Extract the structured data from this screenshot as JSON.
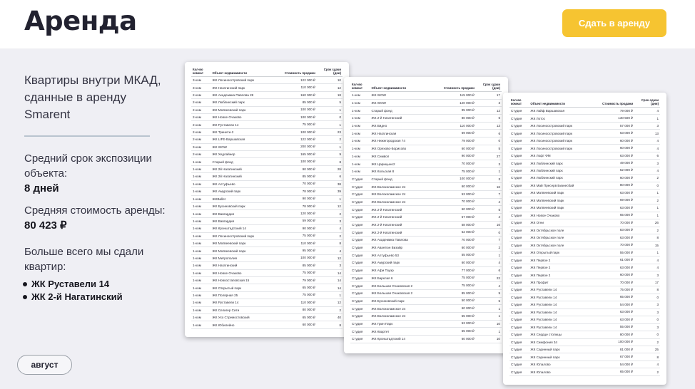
{
  "header": {
    "title": "Аренда",
    "cta_label": "Сдать в аренду"
  },
  "intro": "Квартиры внутри МКАД, сданные в аренду Smarent",
  "stats": {
    "avg_exposure_label": "Средний срок экспозиции объекта:",
    "avg_exposure_value": "8 дней",
    "avg_price_label": "Средняя стоимость аренды:",
    "avg_price_value": "80 423 ₽"
  },
  "most_rented": {
    "label": "Больше всего мы сдали квартир:",
    "items": [
      "ЖК Руставели 14",
      "ЖК 2-й Нагатинский"
    ]
  },
  "month_chip": "август",
  "table_headers": [
    "Кол-во комнат",
    "Объект недвижимости",
    "Стоимость продажи",
    "Срок сдачи (дни)"
  ],
  "sheets": [
    {
      "rows": [
        [
          "3-ком",
          "ЖК Лосиноостровский парк",
          "122 000 ₽",
          "10"
        ],
        [
          "3-ком",
          "ЖК Нагатинский парк",
          "110 000 ₽",
          "12"
        ],
        [
          "2-ком",
          "ЖК Академика Павлова 28",
          "160 000 ₽",
          "18"
        ],
        [
          "2-ком",
          "ЖК Люблинский парк",
          "85 000 ₽",
          "5"
        ],
        [
          "2-ком",
          "ЖК Матвеевский парк",
          "100 000 ₽",
          "1"
        ],
        [
          "2-ком",
          "ЖК Новое Очаково",
          "100 000 ₽",
          "0"
        ],
        [
          "2-ком",
          "ЖК Руставели 14",
          "75 000 ₽",
          "1"
        ],
        [
          "2-ком",
          "ЖК Тринити-2",
          "100 000 ₽",
          "23"
        ],
        [
          "2-ком",
          "ЖК LIFE-Варшавская",
          "122 000 ₽",
          "2"
        ],
        [
          "3-ком",
          "ЖК WOW",
          "200 000 ₽",
          "1"
        ],
        [
          "2-ком",
          "ЖК Хедлайнер",
          "165 000 ₽",
          "9"
        ],
        [
          "1-ком",
          "Старый фонд",
          "100 000 ₽",
          "8"
        ],
        [
          "1-ком",
          "ЖК 2й Нагатинский",
          "90 000 ₽",
          "28"
        ],
        [
          "1-ком",
          "ЖК 2й Нагатинский",
          "85 000 ₽",
          "6"
        ],
        [
          "1-ком",
          "ЖК Алтуфьево",
          "70 000 ₽",
          "38"
        ],
        [
          "1-ком",
          "ЖК Амурский парк",
          "78 000 ₽",
          "39"
        ],
        [
          "1-ком",
          "ЖКBallet",
          "90 000 ₽",
          "1"
        ],
        [
          "1-ком",
          "ЖК Бусиновский парк",
          "78 000 ₽",
          "12"
        ],
        [
          "1-ком",
          "ЖК Вавгардия",
          "120 000 ₽",
          "2"
        ],
        [
          "1-ком",
          "ЖК Вавгардия",
          "59 000 ₽",
          "3"
        ],
        [
          "1-ком",
          "ЖК Кронштадтский 14",
          "90 000 ₽",
          "4"
        ],
        [
          "1-ком",
          "ЖК Лосиноостровский парк",
          "75 000 ₽",
          "2"
        ],
        [
          "1-ком",
          "ЖК Матвеевский парк",
          "110 000 ₽",
          "8"
        ],
        [
          "1-ком",
          "ЖК Матвеевский парк",
          "95 000 ₽",
          "4"
        ],
        [
          "1-ком",
          "ЖК Митрополия",
          "100 000 ₽",
          "12"
        ],
        [
          "1-ком",
          "ЖК Нагатинский",
          "85 000 ₽",
          "3"
        ],
        [
          "1-ком",
          "ЖК Новое Очаково",
          "75 000 ₽",
          "14"
        ],
        [
          "1-ком",
          "ЖК Новоостаповская 15",
          "79 000 ₽",
          "14"
        ],
        [
          "1-ком",
          "ЖК Открытый парк",
          "65 000 ₽",
          "14"
        ],
        [
          "1-ком",
          "ЖК Полярная 25",
          "75 000 ₽",
          "1"
        ],
        [
          "1-ком",
          "ЖК Руставели 14",
          "110 000 ₽",
          "12"
        ],
        [
          "1-ком",
          "ЖК Селигер Сити",
          "80 000 ₽",
          "2"
        ],
        [
          "1-ком",
          "ЖК Ухо Стремостовский",
          "65 000 ₽",
          "40"
        ],
        [
          "1-ком",
          "ЖК Юбилейно",
          "60 000 ₽",
          "8"
        ]
      ]
    },
    {
      "rows": [
        [
          "1-ком",
          "ЖК WOW",
          "115 000 ₽",
          "17"
        ],
        [
          "1-ком",
          "ЖК WOW",
          "120 000 ₽",
          "3"
        ],
        [
          "1-ком",
          "Старый фонд",
          "95 000 ₽",
          "12"
        ],
        [
          "1-ком",
          "ЖК 2-й Нагатинский",
          "80 000 ₽",
          "6"
        ],
        [
          "1-ком",
          "ЖК Видно",
          "110 000 ₽",
          "13"
        ],
        [
          "1-ком",
          "ЖК Нагатинская",
          "69 000 ₽",
          "6"
        ],
        [
          "1-ком",
          "ЖК Нижегородская 74",
          "79 000 ₽",
          "0"
        ],
        [
          "1-ком",
          "ЖК Орехово-Борисово",
          "60 000 ₽",
          "5"
        ],
        [
          "1-ком",
          "ЖК Символ",
          "90 000 ₽",
          "27"
        ],
        [
          "1-ком",
          "ЖК Царицыно2",
          "70 000 ₽",
          "3"
        ],
        [
          "1-ком",
          "ЖК Кольская 8",
          "75 000 ₽",
          "1"
        ],
        [
          "Студия",
          "Старый фонд",
          "100 000 ₽",
          "3"
        ],
        [
          "Студия",
          "ЖК Волоколамское 24",
          "60 000 ₽",
          "16"
        ],
        [
          "Студия",
          "ЖК Волоколамское 24",
          "53 000 ₽",
          "7"
        ],
        [
          "Студия",
          "ЖК Волоколамское 24",
          "70 000 ₽",
          "4"
        ],
        [
          "Студия",
          "ЖК 2-й Нагатинский",
          "60 000 ₽",
          "5"
        ],
        [
          "Студия",
          "ЖК 2-й Нагатинский",
          "57 000 ₽",
          "4"
        ],
        [
          "Студия",
          "ЖК 2-й Нагатинский",
          "58 000 ₽",
          "16"
        ],
        [
          "Студия",
          "ЖК 2-й Нагатинский",
          "52 000 ₽",
          "0"
        ],
        [
          "Студия",
          "ЖК Академика Павлова",
          "70 000 ₽",
          "7"
        ],
        [
          "Студия",
          "ЖК Авантюн Визайр",
          "60 000 ₽",
          "2"
        ],
        [
          "Студия",
          "ЖК Алтуфьево 53",
          "55 000 ₽",
          "1"
        ],
        [
          "Студия",
          "ЖК Амурский парк",
          "60 000 ₽",
          "4"
        ],
        [
          "Студия",
          "ЖК Афи Тауэр",
          "77 000 ₽",
          "6"
        ],
        [
          "Студия",
          "ЖК Барклая 6",
          "75 000 ₽",
          "22"
        ],
        [
          "Студия",
          "ЖК Большая Очаковская 2",
          "75 000 ₽",
          "4"
        ],
        [
          "Студия",
          "ЖК Большая Очаковская 2",
          "85 000 ₽",
          "9"
        ],
        [
          "Студия",
          "ЖК Бусиновский парк",
          "50 000 ₽",
          "5"
        ],
        [
          "Студия",
          "ЖК Волоколамское 24",
          "60 000 ₽",
          "1"
        ],
        [
          "Студия",
          "ЖК Волоколамское 24",
          "55 000 ₽",
          "1"
        ],
        [
          "Студия",
          "ЖК Грин Парк",
          "53 000 ₽",
          "10"
        ],
        [
          "Студия",
          "ЖК Квартет",
          "55 000 ₽",
          "1"
        ],
        [
          "Студия",
          "ЖК Кронштадтский 14",
          "60 000 ₽",
          "10"
        ]
      ]
    },
    {
      "rows": [
        [
          "Студия",
          "ЖК Лайф Варшавская",
          "79 000 ₽",
          "4"
        ],
        [
          "Студия",
          "ЖК Лотос",
          "130 500 ₽",
          "1"
        ],
        [
          "Студия",
          "ЖК Лосиноостровский парк",
          "57 000 ₽",
          "3"
        ],
        [
          "Студия",
          "ЖК Лосиноостровский парк",
          "63 000 ₽",
          "13"
        ],
        [
          "Студия",
          "ЖК Лосиноостровский парк",
          "60 000 ₽",
          "4"
        ],
        [
          "Студия",
          "ЖК Лосиноостровский парк",
          "60 000 ₽",
          "4"
        ],
        [
          "Студия",
          "ЖК Лофт ФМ",
          "63 000 ₽",
          "6"
        ],
        [
          "Студия",
          "ЖК Люблинский парк",
          "49 000 ₽",
          "3"
        ],
        [
          "Студия",
          "ЖК Люблинский парк",
          "52 000 ₽",
          "4"
        ],
        [
          "Студия",
          "ЖК Люблинский парк",
          "60 000 ₽",
          "2"
        ],
        [
          "Студия",
          "ЖК Май Пресерв Бизнесбай",
          "80 000 ₽",
          "0"
        ],
        [
          "Студия",
          "ЖК Матвеевский парк",
          "63 000 ₽",
          "1"
        ],
        [
          "Студия",
          "ЖК Матвеевский парк",
          "69 000 ₽",
          "2"
        ],
        [
          "Студия",
          "ЖК Матвеевский парк",
          "63 000 ₽",
          "1"
        ],
        [
          "Студия",
          "ЖК Новое Очаково",
          "65 000 ₽",
          "1"
        ],
        [
          "Студия",
          "ЖК Огни",
          "70 000 ₽",
          "26"
        ],
        [
          "Студия",
          "ЖК Октябрьское поле",
          "83 000 ₽",
          "2"
        ],
        [
          "Студия",
          "ЖК Октябрьское поле",
          "63 000 ₽",
          "8"
        ],
        [
          "Студия",
          "ЖК Октябрьское поле",
          "70 000 ₽",
          "15"
        ],
        [
          "Студия",
          "ЖК Открытый парк",
          "55 000 ₽",
          "1"
        ],
        [
          "Студия",
          "ЖК Первое 2",
          "61 000 ₽",
          "4"
        ],
        [
          "Студия",
          "ЖК Первое 2",
          "63 000 ₽",
          "4"
        ],
        [
          "Студия",
          "ЖК Первое 2",
          "60 000 ₽",
          "3"
        ],
        [
          "Студия",
          "ЖК Профит",
          "70 000 ₽",
          "17"
        ],
        [
          "Студия",
          "ЖК Руставели 14",
          "75 000 ₽",
          "8"
        ],
        [
          "Студия",
          "ЖК Руставели 14",
          "65 000 ₽",
          "0"
        ],
        [
          "Студия",
          "ЖК Руставели 14",
          "54 000 ₽",
          "3"
        ],
        [
          "Студия",
          "ЖК Руставели 14",
          "63 000 ₽",
          "3"
        ],
        [
          "Студия",
          "ЖК Руставели 14",
          "63 000 ₽",
          "0"
        ],
        [
          "Студия",
          "ЖК Руставели 14",
          "55 000 ₽",
          "3"
        ],
        [
          "Студия",
          "ЖК Сердце столицы",
          "80 000 ₽",
          "0"
        ],
        [
          "Студия",
          "ЖК Симфония 34",
          "100 000 ₽",
          "2"
        ],
        [
          "Студия",
          "ЖК Саринный парк",
          "81 000 ₽",
          "25"
        ],
        [
          "Студия",
          "ЖК Саринный парк",
          "67 000 ₽",
          "8"
        ],
        [
          "Студия",
          "ЖК Юлалово",
          "54 000 ₽",
          "4"
        ],
        [
          "Студия",
          "ЖК Юлалово",
          "65 000 ₽",
          "2"
        ]
      ]
    }
  ]
}
